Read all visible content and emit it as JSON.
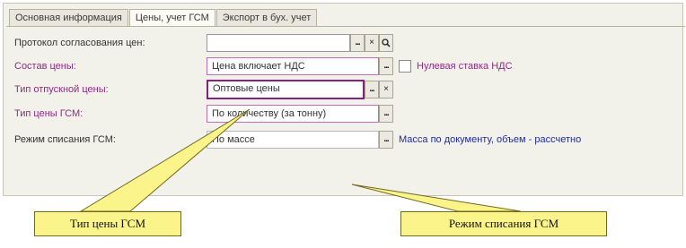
{
  "tabs": [
    {
      "label": "Основная информация",
      "active": false
    },
    {
      "label": "Цены, учет ГСМ",
      "active": true
    },
    {
      "label": "Экспорт в бух. учет",
      "active": false
    }
  ],
  "rows": {
    "protocol": {
      "label": "Протокол согласования цен:",
      "value": ""
    },
    "price_composition": {
      "label": "Состав цены:",
      "value": "Цена включает НДС",
      "checkbox_label": "Нулевая ставка НДС"
    },
    "release_price_type": {
      "label": "Тип отпускной цены:",
      "value": "Оптовые цены"
    },
    "fuel_price_type": {
      "label": "Тип цены ГСМ:",
      "value": "По количеству (за тонну)"
    },
    "writeoff_mode": {
      "label": "Режим списания ГСМ:",
      "value": "По массе",
      "note": "Масса по документу, объем - рассчетно"
    }
  },
  "buttons": {
    "select": "...",
    "clear": "×",
    "search": "🔍"
  },
  "callouts": {
    "left": "Тип цены ГСМ",
    "right": "Режим списания ГСМ"
  },
  "colors": {
    "label_purple": "#8f2a86",
    "note_blue": "#1f2ba0",
    "callout_fill": "#fbf48a"
  }
}
